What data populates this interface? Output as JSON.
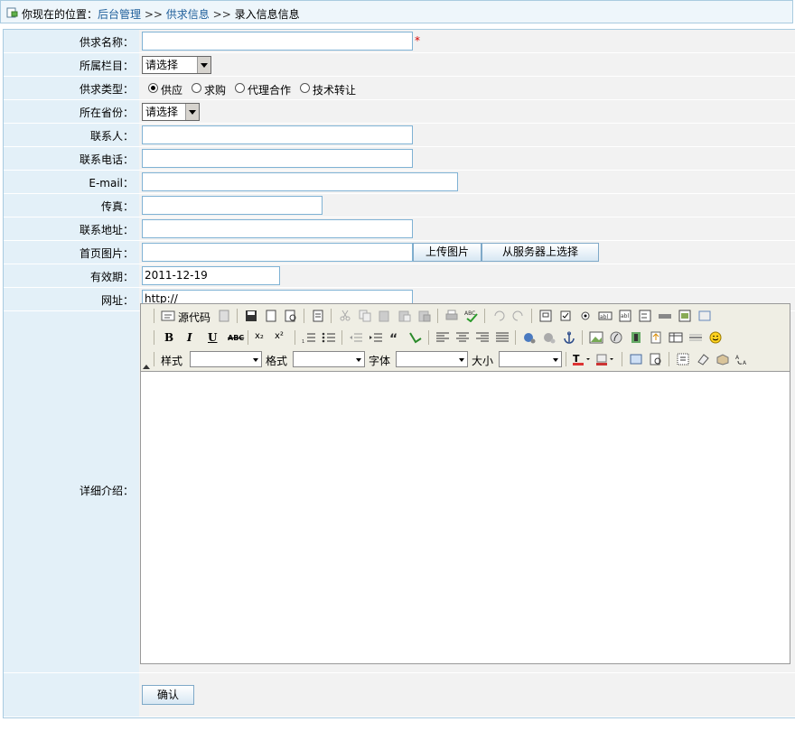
{
  "breadcrumb": {
    "prefix": "你现在的位置：",
    "link1": "后台管理",
    "sep": ">>",
    "link2": "供求信息",
    "current": "录入信息信息"
  },
  "form": {
    "name_label": "供求名称：",
    "name_value": "",
    "required_mark": "*",
    "column_label": "所属栏目：",
    "column_value": "请选择",
    "type_label": "供求类型：",
    "type_options": [
      "供应",
      "求购",
      "代理合作",
      "技术转让"
    ],
    "type_selected": "供应",
    "province_label": "所在省份：",
    "province_value": "请选择",
    "contact_label": "联系人：",
    "phone_label": "联系电话：",
    "email_label": "E-mail：",
    "fax_label": "传真：",
    "address_label": "联系地址：",
    "image_label": "首页图片：",
    "upload_btn": "上传图片",
    "server_btn": "从服务器上选择",
    "expire_label": "有效期：",
    "expire_value": "2011-12-19",
    "url_label": "网址：",
    "url_value": "http://",
    "detail_label": "详细介绍：",
    "confirm_btn": "确认"
  },
  "editor": {
    "source_label": "源代码",
    "style_label": "样式",
    "format_label": "格式",
    "font_label": "字体",
    "size_label": "大小",
    "bold": "B",
    "italic": "I",
    "underline": "U",
    "strike": "ABC",
    "sub": "x₂",
    "sup": "x²"
  }
}
